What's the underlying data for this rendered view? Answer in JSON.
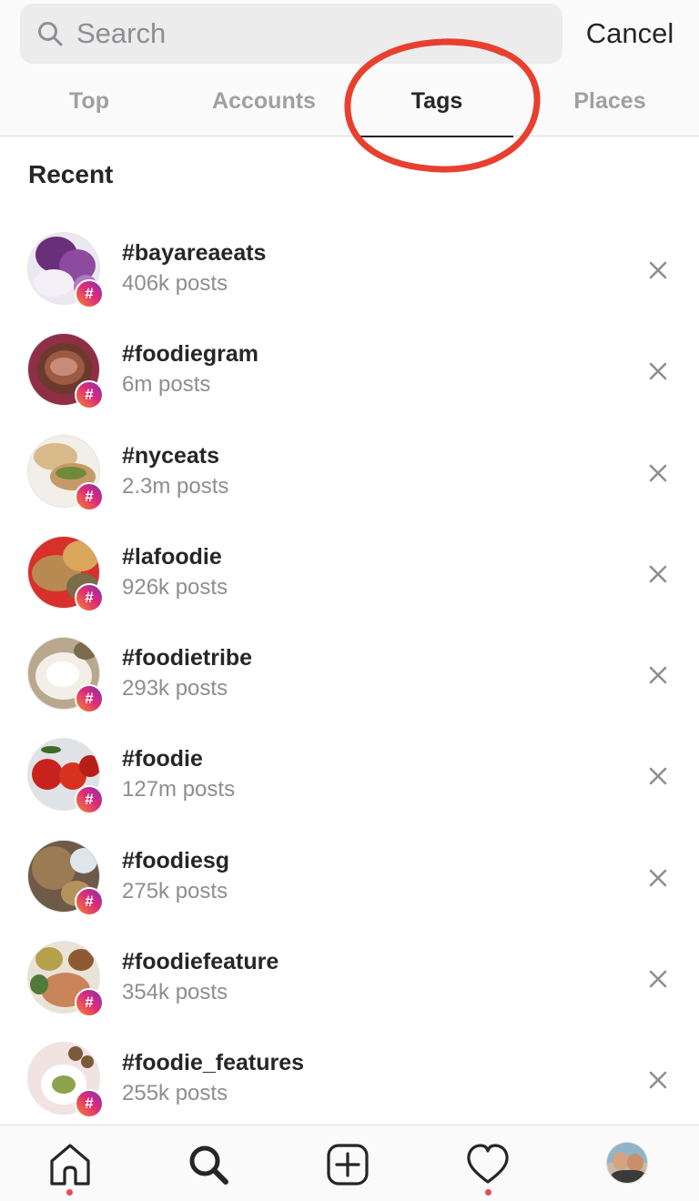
{
  "search": {
    "placeholder": "Search",
    "cancel_label": "Cancel"
  },
  "tabs": [
    {
      "label": "Top",
      "active": false
    },
    {
      "label": "Accounts",
      "active": false
    },
    {
      "label": "Tags",
      "active": true
    },
    {
      "label": "Places",
      "active": false
    }
  ],
  "annotation": {
    "shape": "ellipse",
    "color": "#e8402f",
    "highlights": "Tags"
  },
  "recent": {
    "heading": "Recent",
    "items": [
      {
        "tag": "#bayareaeats",
        "count": "406k posts"
      },
      {
        "tag": "#foodiegram",
        "count": "6m posts"
      },
      {
        "tag": "#nyceats",
        "count": "2.3m posts"
      },
      {
        "tag": "#lafoodie",
        "count": "926k posts"
      },
      {
        "tag": "#foodietribe",
        "count": "293k posts"
      },
      {
        "tag": "#foodie",
        "count": "127m posts"
      },
      {
        "tag": "#foodiesg",
        "count": "275k posts"
      },
      {
        "tag": "#foodiefeature",
        "count": "354k posts"
      },
      {
        "tag": "#foodie_features",
        "count": "255k posts"
      }
    ],
    "badge_symbol": "#",
    "remove_icon": "close-icon"
  },
  "bottom_nav": {
    "items": [
      "home-icon",
      "search-icon",
      "add-post-icon",
      "heart-icon",
      "profile-avatar"
    ],
    "active": "search-icon",
    "notification_dots": [
      "home-icon",
      "heart-icon"
    ]
  },
  "colors": {
    "badge_gradient": [
      "#f58529",
      "#dd2a7b",
      "#8134af"
    ],
    "annotation": "#e8402f",
    "notification_dot": "#ed4956"
  }
}
